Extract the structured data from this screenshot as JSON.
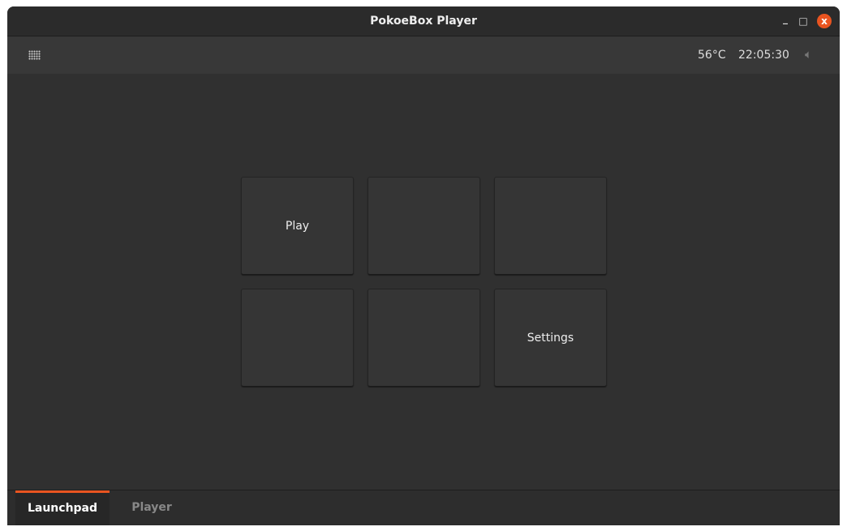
{
  "window": {
    "title": "PokoeBox Player",
    "minimize": "_",
    "maximize": "□",
    "close": "x"
  },
  "toolbar": {
    "temperature": "56°C",
    "time": "22:05:30"
  },
  "tiles": [
    "Play",
    "",
    "",
    "",
    "",
    "Settings"
  ],
  "tabs": [
    {
      "label": "Launchpad",
      "active": true
    },
    {
      "label": "Player",
      "active": false
    }
  ],
  "colors": {
    "accent": "#e95420"
  }
}
